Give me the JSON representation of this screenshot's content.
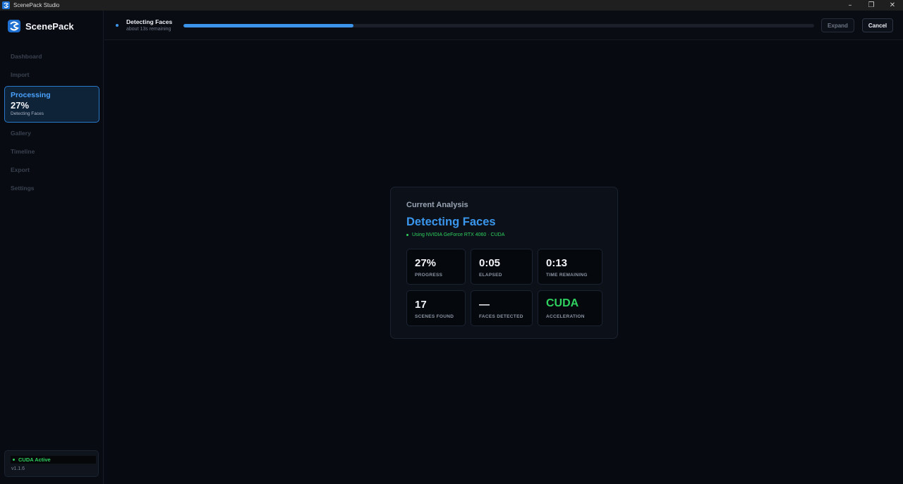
{
  "window": {
    "title": "ScenePack Studio",
    "controls": [
      "minimize-icon",
      "restore-icon",
      "close-icon"
    ]
  },
  "brand": {
    "name": "ScenePack"
  },
  "sidebar": {
    "items_before": [
      {
        "label": "Dashboard"
      },
      {
        "label": "Import"
      }
    ],
    "active": {
      "label": "Processing",
      "percent": "27%",
      "stage": "Detecting Faces"
    },
    "items_after": [
      {
        "label": "Gallery"
      },
      {
        "label": "Timeline"
      },
      {
        "label": "Export"
      },
      {
        "label": "Settings"
      }
    ],
    "status": {
      "cuda_label": "CUDA Active",
      "version": "v1.1.6"
    }
  },
  "topbar": {
    "task_title": "Detecting Faces",
    "eta": "about 13s remaining",
    "progress_fraction": 0.27,
    "expand_label": "Expand",
    "cancel_label": "Cancel"
  },
  "analysis": {
    "heading": "Current Analysis",
    "title": "Detecting Faces",
    "gpu": "Using NVIDIA GeForce RTX 4060 · CUDA",
    "stats": [
      {
        "value": "27%",
        "caption": "PROGRESS"
      },
      {
        "value": "0:05",
        "caption": "ELAPSED"
      },
      {
        "value": "0:13",
        "caption": "TIME REMAINING"
      },
      {
        "value": "17",
        "caption": "SCENES FOUND"
      },
      {
        "value": "—",
        "caption": "FACES DETECTED"
      },
      {
        "value": "CUDA",
        "caption": "ACCELERATION"
      }
    ]
  },
  "colors": {
    "accent": "#3b96ee",
    "success": "#2fd15f",
    "background": "#070a10"
  }
}
